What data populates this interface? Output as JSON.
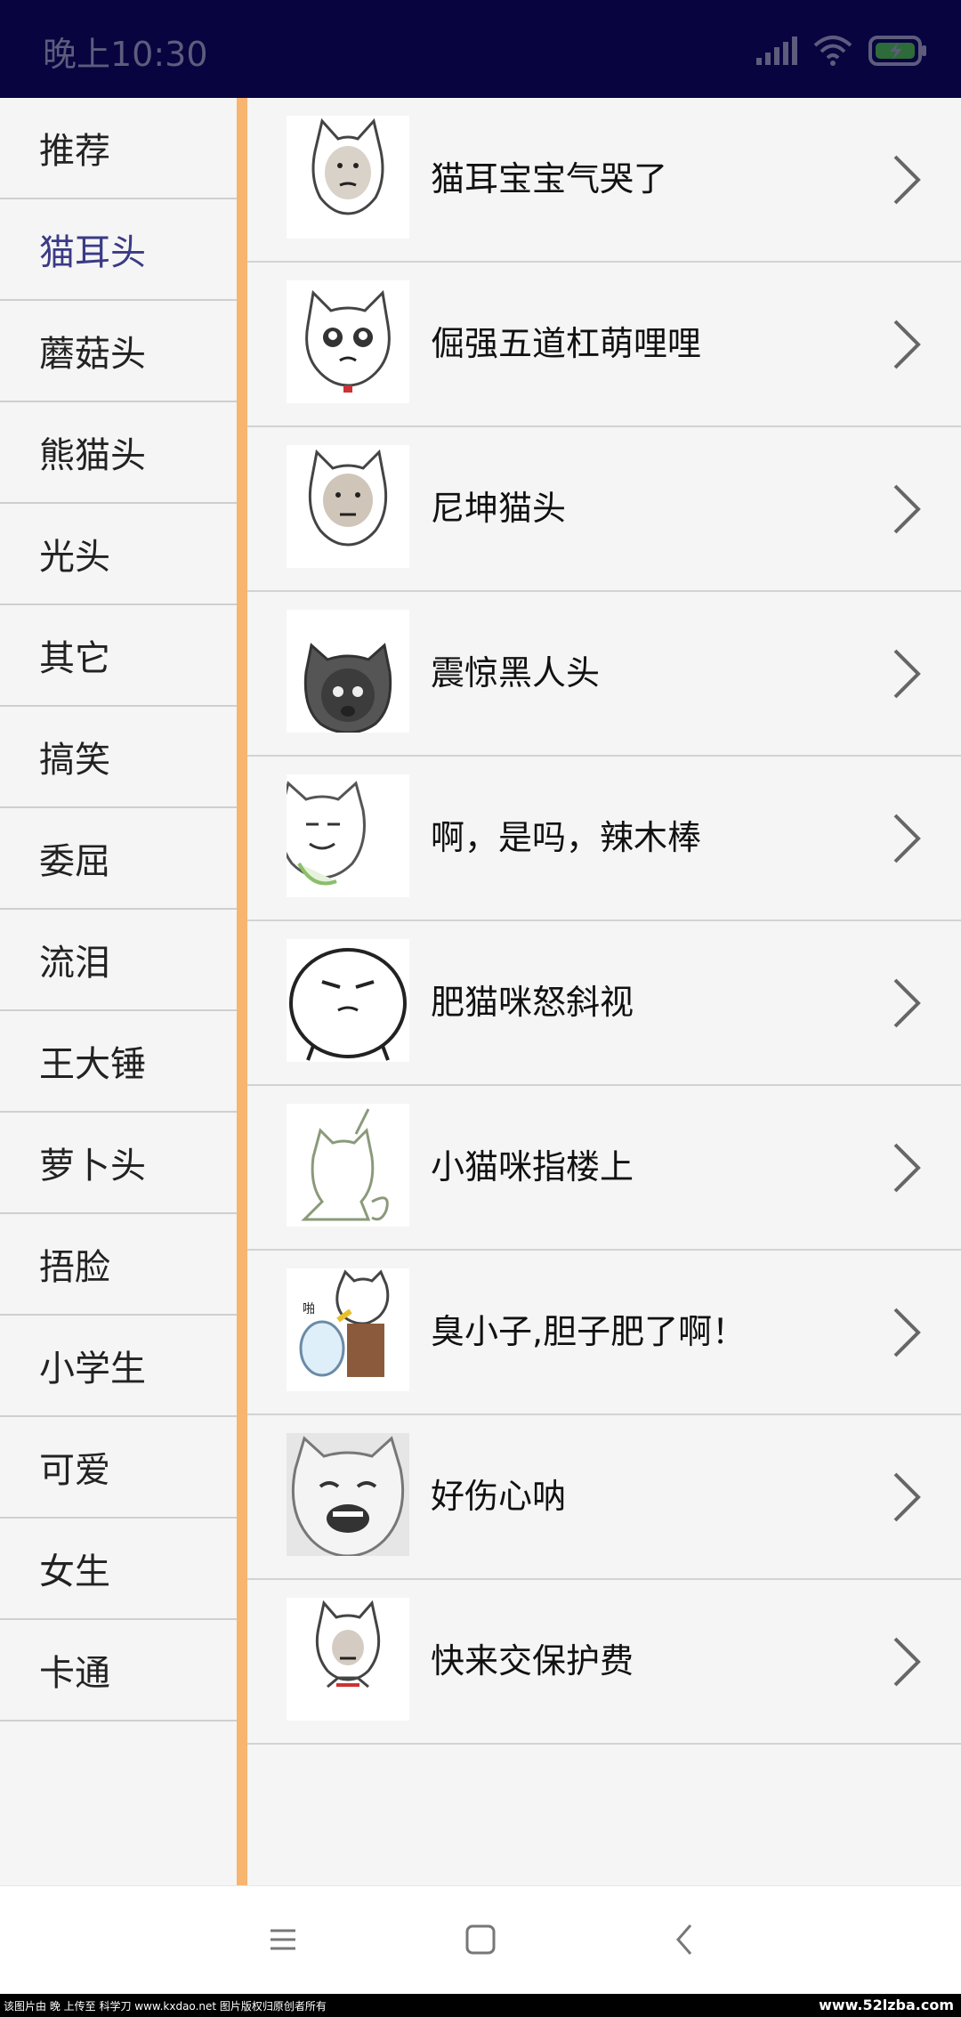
{
  "status_bar": {
    "time": "晚上10:30"
  },
  "sidebar": {
    "active_index": 1,
    "items": [
      {
        "label": "推荐"
      },
      {
        "label": "猫耳头"
      },
      {
        "label": "蘑菇头"
      },
      {
        "label": "熊猫头"
      },
      {
        "label": "光头"
      },
      {
        "label": "其它"
      },
      {
        "label": "搞笑"
      },
      {
        "label": "委屈"
      },
      {
        "label": "流泪"
      },
      {
        "label": "王大锤"
      },
      {
        "label": "萝卜头"
      },
      {
        "label": "捂脸"
      },
      {
        "label": "小学生"
      },
      {
        "label": "可爱"
      },
      {
        "label": "女生"
      },
      {
        "label": "卡通"
      }
    ]
  },
  "list": {
    "items": [
      {
        "title": "猫耳宝宝气哭了"
      },
      {
        "title": "倔强五道杠萌哩哩"
      },
      {
        "title": "尼坤猫头"
      },
      {
        "title": "震惊黑人头"
      },
      {
        "title": "啊，是吗，辣木棒"
      },
      {
        "title": "肥猫咪怒斜视"
      },
      {
        "title": "小猫咪指楼上"
      },
      {
        "title": "臭小子,胆子肥了啊！"
      },
      {
        "title": "好伤心呐"
      },
      {
        "title": "快来交保护费"
      }
    ]
  },
  "watermark": {
    "left_text": "该图片由 晚 上传至 科学刀 www.kxdao.net 图片版权归原创者所有",
    "right_text": "www.52lzba.com"
  },
  "colors": {
    "status_bar_bg": "#070440",
    "active_tab_text": "#3a3a86",
    "sidebar_divider": "#f7b56f"
  }
}
